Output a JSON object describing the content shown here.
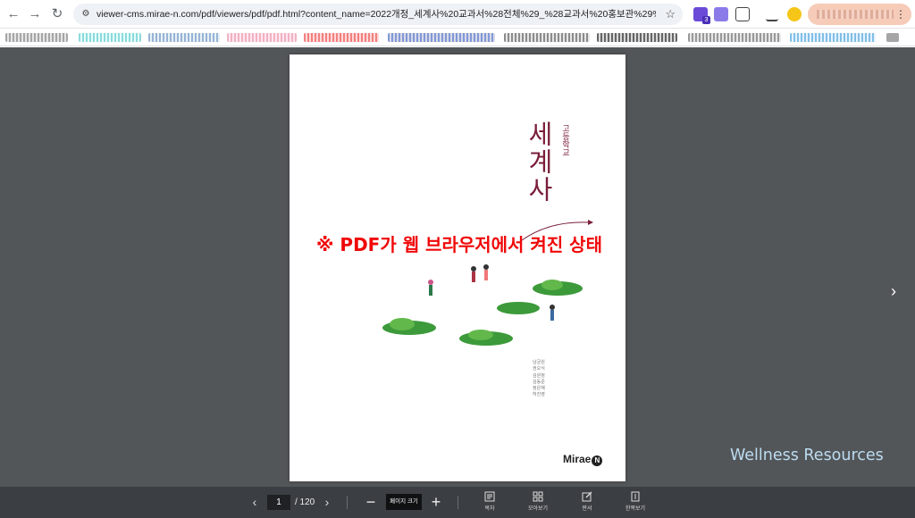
{
  "browser": {
    "url": "viewer-cms.mirae-n.com/pdf/viewers/pdf/pdf.html?content_name=2022개정_세계사%20교과서%28전체%29_%28교과서%20홍보관%29%28&file=https:...",
    "nav": {
      "back": "←",
      "forward": "→",
      "reload": "↻",
      "site_info": "⚙",
      "bookmark": "☆",
      "menu": "⋮"
    },
    "extension_badge": "3"
  },
  "pdf_page": {
    "title": "세계사",
    "subtitle": "고등학교",
    "authors": [
      "남궁원",
      "권오식",
      "김원정",
      "김동준",
      "정은혜",
      "허진영"
    ],
    "publisher": "Mirae",
    "publisher_mark": "N"
  },
  "overlay_note": "※ PDF가 웹 브라우저에서 켜진 상태",
  "watermark": "Wellness Resources",
  "viewer_nav": {
    "next": "›"
  },
  "bottom_bar": {
    "prev": "‹",
    "next": "›",
    "current_page": "1",
    "total_pages": "/ 120",
    "zoom_out": "−",
    "zoom_label": "페이지 크기",
    "zoom_in": "+",
    "tools": [
      {
        "label": "목차",
        "icon": "toc-icon"
      },
      {
        "label": "모아보기",
        "icon": "grid-icon"
      },
      {
        "label": "판서",
        "icon": "pen-icon"
      },
      {
        "label": "한쪽보기",
        "icon": "single-page-icon"
      }
    ]
  },
  "colors": {
    "viewer_bg": "#535659",
    "bottom_bar_bg": "#3b3e42",
    "title_color": "#7a1e3a",
    "overlay_color": "#f00808",
    "watermark_color": "#bcdcf0"
  }
}
